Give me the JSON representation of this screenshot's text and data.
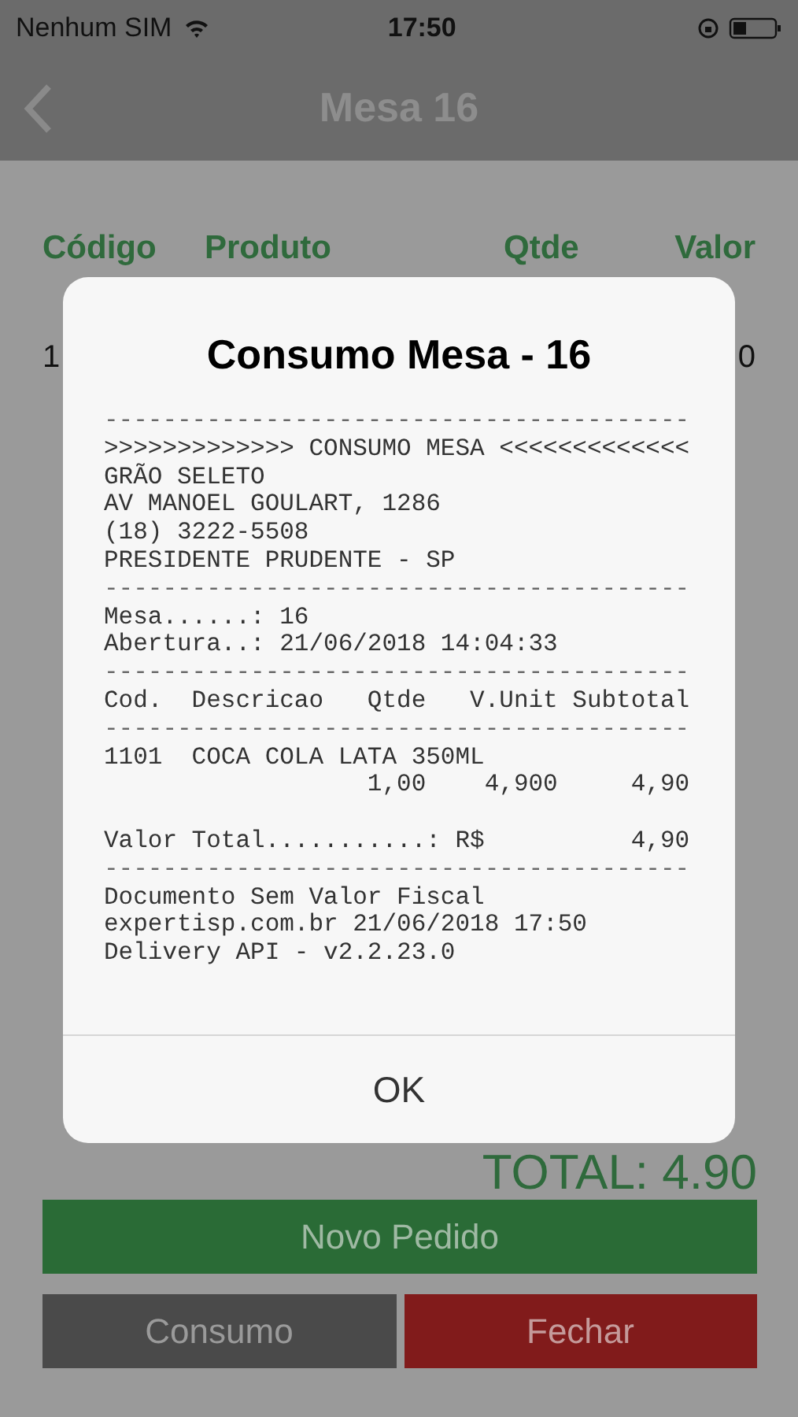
{
  "status_bar": {
    "carrier": "Nenhum SIM",
    "time": "17:50"
  },
  "nav_bar": {
    "title": "Mesa 16"
  },
  "table": {
    "columns": [
      "Código",
      "Produto",
      "Qtde",
      "Valor"
    ],
    "rows": [
      {
        "cells": [
          "1",
          "",
          "",
          "0"
        ]
      }
    ]
  },
  "total": "TOTAL: 4.90",
  "buttons": [
    {
      "label": "Novo Pedido",
      "kind": "primary"
    },
    {
      "label": "Consumo",
      "kind": "neutral"
    },
    {
      "label": "Fechar",
      "kind": "danger"
    }
  ],
  "dialog": {
    "title": "Consumo Mesa - 16",
    "receipt": [
      {
        "kind": "rule",
        "text": "----------------------------------------"
      },
      {
        "kind": "text",
        "text": ">>>>>>>>>>>>> CONSUMO MESA <<<<<<<<<<<<<"
      },
      {
        "kind": "text",
        "text": "GRÃO SELETO"
      },
      {
        "kind": "text",
        "text": "AV MANOEL GOULART, 1286"
      },
      {
        "kind": "text",
        "text": "(18) 3222-5508"
      },
      {
        "kind": "text",
        "text": "PRESIDENTE PRUDENTE - SP"
      },
      {
        "kind": "rule",
        "text": "----------------------------------------"
      },
      {
        "kind": "text",
        "text": "Mesa......: 16"
      },
      {
        "kind": "text",
        "text": "Abertura..: 21/06/2018 14:04:33"
      },
      {
        "kind": "rule",
        "text": "----------------------------------------"
      },
      {
        "kind": "text",
        "text": "Cod.  Descricao   Qtde   V.Unit Subtotal"
      },
      {
        "kind": "rule",
        "text": "----------------------------------------"
      },
      {
        "kind": "text",
        "text": "1101  COCA COLA LATA 350ML"
      },
      {
        "kind": "text",
        "text": "                  1,00    4,900     4,90"
      },
      {
        "kind": "text",
        "text": "Valor Total...........: R$          4,90",
        "spaced": true
      },
      {
        "kind": "rule",
        "text": "----------------------------------------"
      },
      {
        "kind": "text",
        "text": "Documento Sem Valor Fiscal"
      },
      {
        "kind": "text",
        "text": "expertisp.com.br 21/06/2018 17:50"
      },
      {
        "kind": "text",
        "text": "Delivery API - v2.2.23.0"
      }
    ],
    "button": "OK"
  }
}
